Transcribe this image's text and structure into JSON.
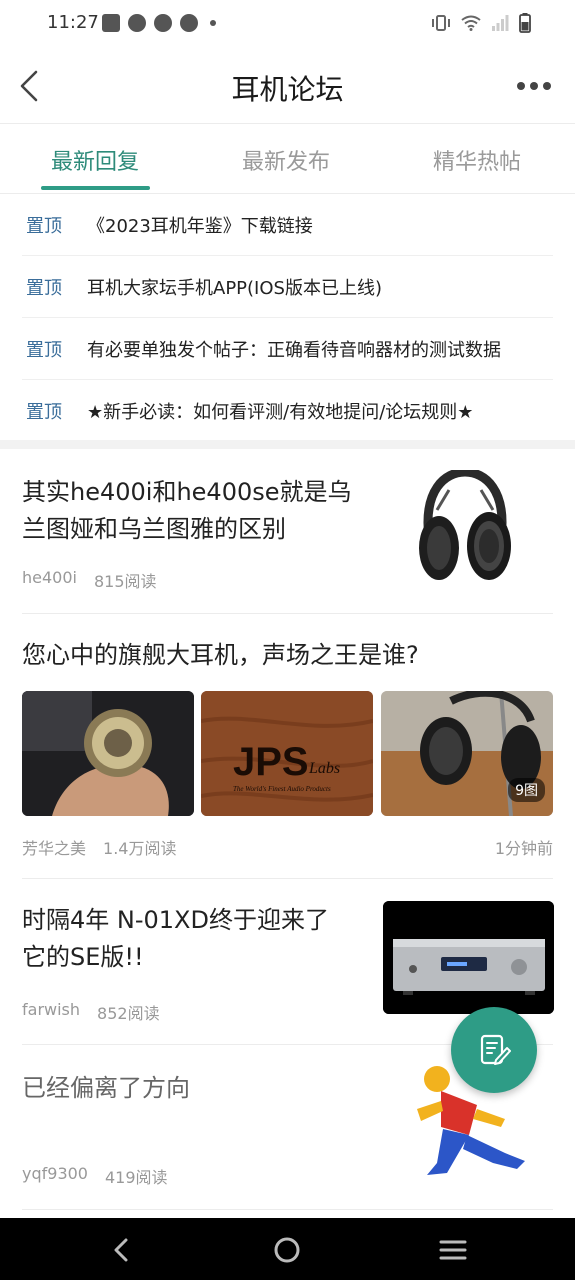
{
  "status_bar": {
    "time": "11:27"
  },
  "header": {
    "title": "耳机论坛"
  },
  "tabs": [
    {
      "label": "最新回复"
    },
    {
      "label": "最新发布"
    },
    {
      "label": "精华热帖"
    }
  ],
  "pinned": [
    {
      "tag": "置顶",
      "title": "《2023耳机年鉴》下载链接"
    },
    {
      "tag": "置顶",
      "title": "耳机大家坛手机APP(IOS版本已上线)"
    },
    {
      "tag": "置顶",
      "title": "有必要单独发个帖子：正确看待音响器材的测试数据"
    },
    {
      "tag": "置顶",
      "title": "★新手必读：如何看评测/有效地提问/论坛规则★"
    }
  ],
  "posts": [
    {
      "title": "其实he400i和he400se就是乌兰图娅和乌兰图雅的区别",
      "author": "he400i",
      "reads": "815阅读",
      "time": ""
    },
    {
      "title": "您心中的旗舰大耳机，声场之王是谁?",
      "author": "芳华之美",
      "reads": "1.4万阅读",
      "time": "1分钟前",
      "image_count": "9图",
      "logo_text": "JPS",
      "logo_sub": "Labs",
      "logo_tagline": "The World's Finest Audio Products"
    },
    {
      "title": "时隔4年 N-01XD终于迎来了它的SE版!!",
      "author": "farwish",
      "reads": "852阅读",
      "time": ""
    },
    {
      "title": "已经偏离了方向",
      "author": "yqf9300",
      "reads": "419阅读",
      "time": ""
    }
  ],
  "colors": {
    "accent": "#2e9c86",
    "pin_tag": "#3a6d9a",
    "meta": "#999999"
  },
  "icons": {
    "back": "back-arrow-icon",
    "more": "more-dots-icon",
    "compose": "edit-note-icon"
  }
}
